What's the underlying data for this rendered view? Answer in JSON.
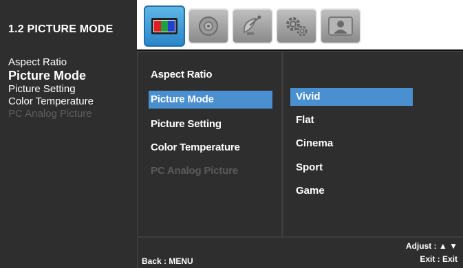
{
  "help": {
    "title": "1.2 PICTURE MODE",
    "items": [
      {
        "label": "Aspect Ratio",
        "state": "normal"
      },
      {
        "label": "Picture Mode",
        "state": "active"
      },
      {
        "label": "Picture Setting",
        "state": "normal"
      },
      {
        "label": "Color Temperature",
        "state": "normal"
      },
      {
        "label": "PC Analog Picture",
        "state": "disabled"
      }
    ]
  },
  "tabs": [
    {
      "icon": "picture-icon",
      "selected": true
    },
    {
      "icon": "sound-icon",
      "selected": false
    },
    {
      "icon": "satellite-icon",
      "selected": false
    },
    {
      "icon": "setup-gear-icon",
      "selected": false
    },
    {
      "icon": "user-icon",
      "selected": false
    }
  ],
  "menu": {
    "items": [
      {
        "label": "Aspect Ratio",
        "state": "normal"
      },
      {
        "label": "Picture Mode",
        "state": "selected"
      },
      {
        "label": "Picture Setting",
        "state": "normal"
      },
      {
        "label": "Color Temperature",
        "state": "normal"
      },
      {
        "label": "PC Analog Picture",
        "state": "disabled"
      }
    ]
  },
  "options": {
    "items": [
      {
        "label": "Vivid",
        "selected": true
      },
      {
        "label": "Flat",
        "selected": false
      },
      {
        "label": "Cinema",
        "selected": false
      },
      {
        "label": "Sport",
        "selected": false
      },
      {
        "label": "Game",
        "selected": false
      }
    ]
  },
  "footer": {
    "back": "Back : MENU",
    "adjust": "Adjust : ▲ ▼",
    "exit": "Exit : Exit"
  },
  "colors": {
    "highlight": "#4a8fd0",
    "panel": "#2e2e2e",
    "tab_selected": "#2a86c8",
    "disabled_text": "#5a5a5a"
  }
}
